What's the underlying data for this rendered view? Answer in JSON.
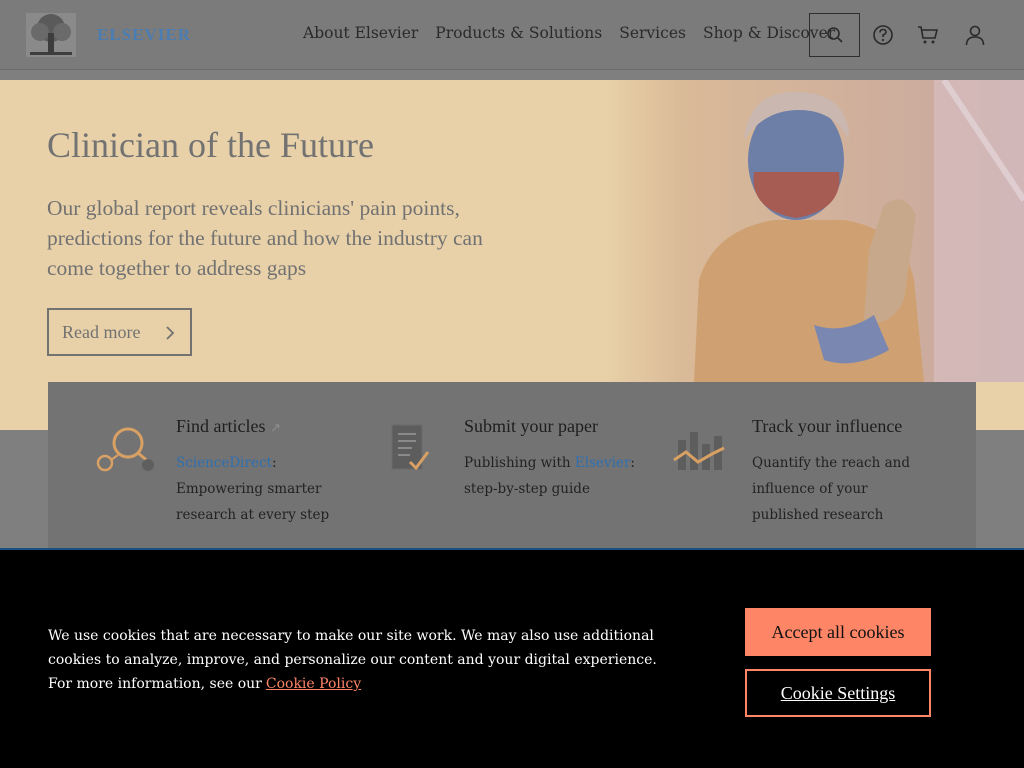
{
  "header": {
    "brand": "ELSEVIER",
    "nav": [
      "About Elsevier",
      "Products & Solutions",
      "Services",
      "Shop & Discover"
    ],
    "icons": [
      "search-icon",
      "help-icon",
      "cart-icon",
      "user-icon"
    ]
  },
  "hero": {
    "title": "Clinician of the Future",
    "text": "Our global report reveals clinicians' pain points, predictions for the future and how the industry can come together to address gaps",
    "button": "Read more"
  },
  "cards": [
    {
      "title": "Find articles",
      "link": "ScienceDirect",
      "after_link": ":",
      "desc": "Empowering smarter research at every step",
      "icon": "magnifier-icon"
    },
    {
      "title": "Submit your paper",
      "pre": "Publishing with ",
      "link": "Elsevier",
      "after_link": ":",
      "desc": "step-by-step guide",
      "icon": "document-check-icon"
    },
    {
      "title": "Track your influence",
      "desc": "Quantify the reach and influence of your published research",
      "icon": "chart-icon"
    }
  ],
  "cookie": {
    "text": "We use cookies that are necessary to make our site work. We may also use additional cookies to analyze, improve, and personalize our content and your digital experience. For more information, see our",
    "link": "Cookie Policy",
    "accept": "Accept all cookies",
    "settings": "Cookie Settings"
  },
  "colors": {
    "accent": "#ff8567",
    "link": "#2f6fb0",
    "hero_bg": "#e8d1a8"
  }
}
